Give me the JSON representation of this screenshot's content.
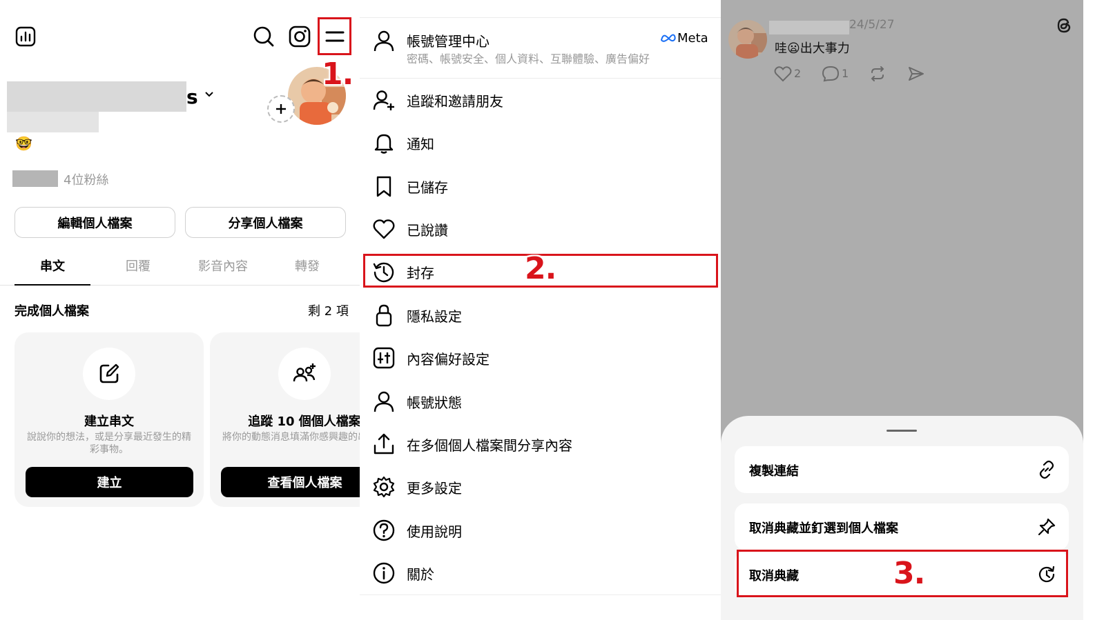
{
  "profile": {
    "name_suffix": "s",
    "emoji": "🤓",
    "followers": "4位粉絲",
    "edit_button": "編輯個人檔案",
    "share_button": "分享個人檔案",
    "tabs": [
      "串文",
      "回覆",
      "影音內容",
      "轉發"
    ],
    "complete_title": "完成個人檔案",
    "remaining": "剩 2 項",
    "cards": [
      {
        "title": "建立串文",
        "desc": "說說你的想法，或是分享最近發生的精彩事物。",
        "button": "建立"
      },
      {
        "title": "追蹤 10 個個人檔案",
        "desc": "將你的動態消息填滿你感興趣的串文。",
        "button": "查看個人檔案"
      }
    ]
  },
  "menu": {
    "account_center": {
      "title": "帳號管理中心",
      "subtitle": "密碼、帳號安全、個人資料、互聯體驗、廣告偏好",
      "brand": "Meta"
    },
    "items": [
      {
        "label": "追蹤和邀請朋友",
        "icon": "add-person-icon"
      },
      {
        "label": "通知",
        "icon": "bell-icon"
      },
      {
        "label": "已儲存",
        "icon": "bookmark-icon"
      },
      {
        "label": "已說讚",
        "icon": "heart-icon"
      },
      {
        "label": "封存",
        "icon": "archive-history-icon"
      },
      {
        "label": "隱私設定",
        "icon": "lock-icon"
      },
      {
        "label": "內容偏好設定",
        "icon": "sliders-icon"
      },
      {
        "label": "帳號狀態",
        "icon": "person-icon"
      },
      {
        "label": "在多個個人檔案間分享內容",
        "icon": "share-upload-icon"
      },
      {
        "label": "更多設定",
        "icon": "gear-icon"
      },
      {
        "label": "使用說明",
        "icon": "help-icon"
      },
      {
        "label": "關於",
        "icon": "info-icon"
      }
    ]
  },
  "archive": {
    "post": {
      "date": "24/5/27",
      "text_before": "哇",
      "text_emoji": "😦",
      "text_after": "出大事力",
      "likes": "2",
      "replies": "1"
    },
    "sheet": [
      {
        "label": "複製連結",
        "icon": "link-icon"
      },
      {
        "label": "取消典藏並釘選到個人檔案",
        "icon": "pin-icon"
      },
      {
        "label": "取消典藏",
        "icon": "unarchive-icon"
      }
    ]
  },
  "annotations": {
    "step1": "1.",
    "step2": "2.",
    "step3": "3."
  },
  "colors": {
    "annotation_red": "#d9141b",
    "overlay_gray": "#adadad",
    "button_black": "#000000"
  }
}
